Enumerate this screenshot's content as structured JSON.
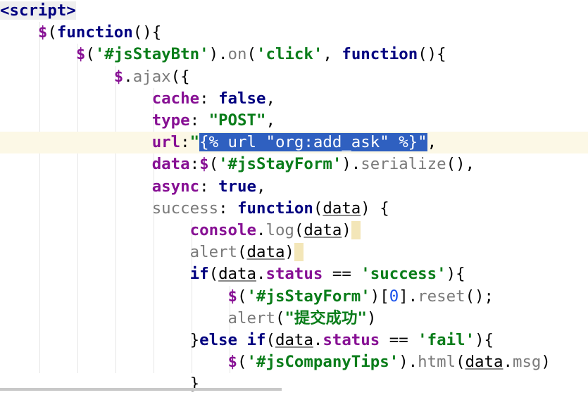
{
  "editor": {
    "current_line": 6,
    "lines": [
      [
        [
          "<script>",
          "tag"
        ]
      ],
      [
        [
          "    ",
          ""
        ],
        [
          "$",
          "dollar"
        ],
        [
          "(",
          "plain"
        ],
        [
          "function",
          "kw"
        ],
        [
          "(){",
          "plain"
        ]
      ],
      [
        [
          "        ",
          ""
        ],
        [
          "$",
          "dollar"
        ],
        [
          "(",
          "plain"
        ],
        [
          "'#jsStayBtn'",
          "str"
        ],
        [
          ").",
          "plain"
        ],
        [
          "on",
          "meth"
        ],
        [
          "(",
          "plain"
        ],
        [
          "'click'",
          "str"
        ],
        [
          ", ",
          "plain"
        ],
        [
          "function",
          "kw"
        ],
        [
          "(){",
          "plain"
        ]
      ],
      [
        [
          "            ",
          ""
        ],
        [
          "$",
          "dollar"
        ],
        [
          ".",
          "plain"
        ],
        [
          "ajax",
          "meth"
        ],
        [
          "({",
          "plain"
        ]
      ],
      [
        [
          "                ",
          ""
        ],
        [
          "cache",
          "prop"
        ],
        [
          ": ",
          "plain"
        ],
        [
          "false",
          "kw"
        ],
        [
          ",",
          "plain"
        ]
      ],
      [
        [
          "                ",
          ""
        ],
        [
          "type",
          "prop"
        ],
        [
          ": ",
          "plain"
        ],
        [
          "\"POST\"",
          "str"
        ],
        [
          ",",
          "plain"
        ]
      ],
      [
        [
          "                ",
          ""
        ],
        [
          "url",
          "prop"
        ],
        [
          ":",
          "plain"
        ],
        [
          "\"",
          "str"
        ],
        [
          "{% url \"org:add_ask\" %}\"",
          "sel"
        ],
        [
          ",",
          "plain"
        ]
      ],
      [
        [
          "                ",
          ""
        ],
        [
          "data",
          "prop"
        ],
        [
          ":",
          "plain"
        ],
        [
          "$",
          "dollar"
        ],
        [
          "(",
          "plain"
        ],
        [
          "'#jsStayForm'",
          "str"
        ],
        [
          ").",
          "plain"
        ],
        [
          "serialize",
          "meth"
        ],
        [
          "(),",
          "plain"
        ]
      ],
      [
        [
          "                ",
          ""
        ],
        [
          "async",
          "prop"
        ],
        [
          ": ",
          "plain"
        ],
        [
          "true",
          "kw"
        ],
        [
          ",",
          "plain"
        ]
      ],
      [
        [
          "                ",
          ""
        ],
        [
          "success",
          "meth"
        ],
        [
          ": ",
          "plain"
        ],
        [
          "function",
          "kw"
        ],
        [
          "(",
          "plain"
        ],
        [
          "data",
          "param"
        ],
        [
          ") {",
          "plain"
        ]
      ],
      [
        [
          "                    ",
          ""
        ],
        [
          "console",
          "prop"
        ],
        [
          ".",
          "plain"
        ],
        [
          "log",
          "meth"
        ],
        [
          "(",
          "plain"
        ],
        [
          "data",
          "param"
        ],
        [
          ")",
          "plain"
        ],
        [
          " ",
          "caret-mark"
        ]
      ],
      [
        [
          "                    ",
          ""
        ],
        [
          "alert",
          "meth"
        ],
        [
          "(",
          "plain"
        ],
        [
          "data",
          "param"
        ],
        [
          ")",
          "plain"
        ],
        [
          " ",
          "caret-mark"
        ]
      ],
      [
        [
          "                    ",
          ""
        ],
        [
          "if",
          "kw"
        ],
        [
          "(",
          "plain"
        ],
        [
          "data",
          "param"
        ],
        [
          ".",
          "plain"
        ],
        [
          "status",
          "prop"
        ],
        [
          " == ",
          "plain"
        ],
        [
          "'success'",
          "str"
        ],
        [
          "){",
          "plain"
        ]
      ],
      [
        [
          "                        ",
          ""
        ],
        [
          "$",
          "dollar"
        ],
        [
          "(",
          "plain"
        ],
        [
          "'#jsStayForm'",
          "str"
        ],
        [
          ")[",
          "plain"
        ],
        [
          "0",
          "num"
        ],
        [
          "].",
          "plain"
        ],
        [
          "reset",
          "meth"
        ],
        [
          "();",
          "plain"
        ]
      ],
      [
        [
          "                        ",
          ""
        ],
        [
          "alert",
          "meth"
        ],
        [
          "(",
          "plain"
        ],
        [
          "\"提交成功\"",
          "str"
        ],
        [
          ")",
          "plain"
        ]
      ],
      [
        [
          "                    ",
          ""
        ],
        [
          "}",
          "plain"
        ],
        [
          "else",
          "kw"
        ],
        [
          " ",
          "plain"
        ],
        [
          "if",
          "kw"
        ],
        [
          "(",
          "plain"
        ],
        [
          "data",
          "param"
        ],
        [
          ".",
          "plain"
        ],
        [
          "status",
          "prop"
        ],
        [
          " == ",
          "plain"
        ],
        [
          "'fail'",
          "str"
        ],
        [
          "){",
          "plain"
        ]
      ],
      [
        [
          "                        ",
          ""
        ],
        [
          "$",
          "dollar"
        ],
        [
          "(",
          "plain"
        ],
        [
          "'#jsCompanyTips'",
          "str"
        ],
        [
          ").",
          "plain"
        ],
        [
          "html",
          "meth"
        ],
        [
          "(",
          "plain"
        ],
        [
          "data",
          "param"
        ],
        [
          ".",
          "plain"
        ],
        [
          "msg",
          "meth"
        ],
        [
          ")",
          "plain"
        ]
      ],
      [
        [
          "                    ",
          ""
        ],
        [
          "}",
          "plain"
        ]
      ]
    ]
  }
}
